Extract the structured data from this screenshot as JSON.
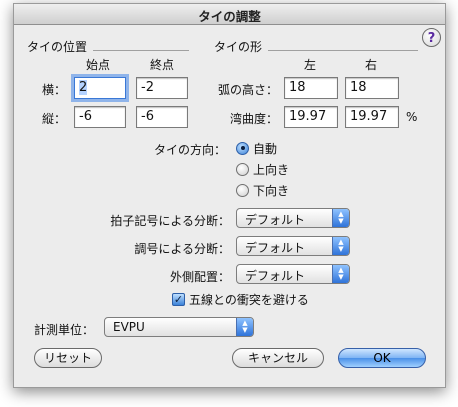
{
  "dialog": {
    "title": "タイの調整",
    "help_label": "?"
  },
  "position": {
    "section_title": "タイの位置",
    "col_start": "始点",
    "col_end": "終点",
    "row_horizontal": "横：",
    "row_vertical": "縦：",
    "h_start": "2",
    "h_end": "-2",
    "v_start": "-6",
    "v_end": "-6"
  },
  "shape": {
    "section_title": "タイの形",
    "col_left": "左",
    "col_right": "右",
    "row_height": "弧の高さ：",
    "row_inset": "湾曲度：",
    "height_left": "18",
    "height_right": "18",
    "inset_left": "19.97",
    "inset_right": "19.97",
    "inset_unit": "%"
  },
  "direction": {
    "label": "タイの方向：",
    "options": [
      {
        "label": "自動",
        "selected": true
      },
      {
        "label": "上向き",
        "selected": false
      },
      {
        "label": "下向き",
        "selected": false
      }
    ]
  },
  "breaks": {
    "time_sig_label": "拍子記号による分断：",
    "time_sig_value": "デフォルト",
    "key_sig_label": "調号による分断：",
    "key_sig_value": "デフォルト",
    "outer_label": "外側配置：",
    "outer_value": "デフォルト"
  },
  "avoid_staff": {
    "label": "五線との衝突を避ける",
    "checked": true
  },
  "units": {
    "label": "計測単位：",
    "value": "EVPU"
  },
  "buttons": {
    "reset": "リセット",
    "cancel": "キャンセル",
    "ok": "OK"
  }
}
